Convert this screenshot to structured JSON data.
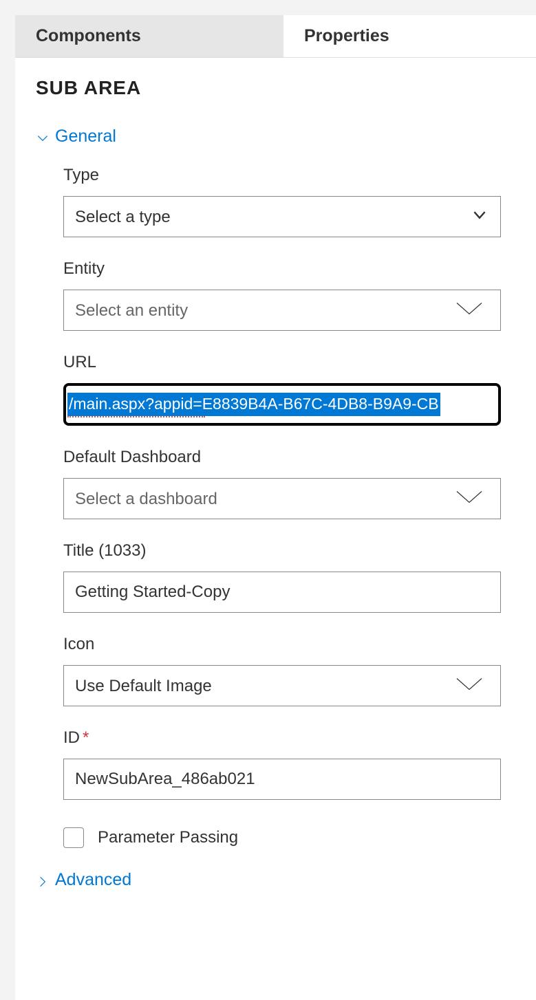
{
  "tabs": {
    "components": "Components",
    "properties": "Properties"
  },
  "section_title": "SUB AREA",
  "sections": {
    "general": "General",
    "advanced": "Advanced"
  },
  "fields": {
    "type": {
      "label": "Type",
      "placeholder": "Select a type"
    },
    "entity": {
      "label": "Entity",
      "placeholder": "Select an entity"
    },
    "url": {
      "label": "URL",
      "value": "/main.aspx?appid=E8839B4A-B67C-4DB8-B9A9-CB"
    },
    "dashboard": {
      "label": "Default Dashboard",
      "placeholder": "Select a dashboard"
    },
    "title": {
      "label": "Title (1033)",
      "value": "Getting Started-Copy"
    },
    "icon": {
      "label": "Icon",
      "value": "Use Default Image"
    },
    "id": {
      "label": "ID",
      "value": "NewSubArea_486ab021"
    },
    "param_passing": {
      "label": "Parameter Passing",
      "checked": false
    }
  }
}
